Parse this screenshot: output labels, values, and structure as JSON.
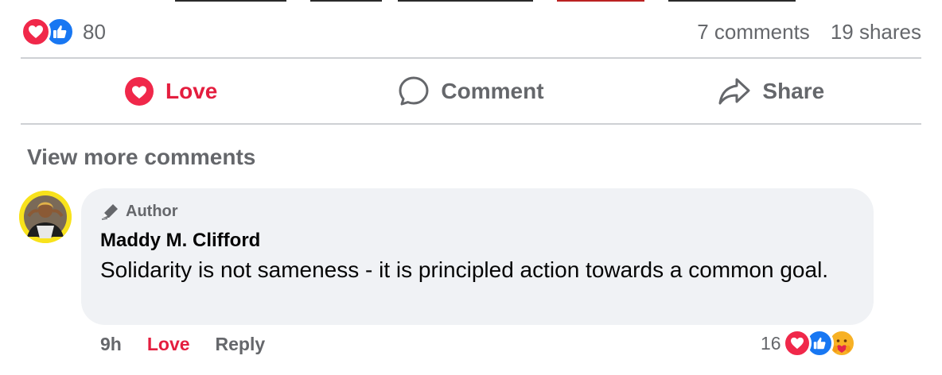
{
  "post": {
    "reaction_count": "80",
    "reaction_icons": [
      "love-icon",
      "like-icon"
    ],
    "comments_count": "7 comments",
    "shares_count": "19 shares"
  },
  "actions": {
    "love_label": "Love",
    "comment_label": "Comment",
    "share_label": "Share"
  },
  "comments_section": {
    "view_more": "View more comments",
    "comment": {
      "author_badge": "Author",
      "commenter_name": "Maddy M. Clifford",
      "text": "Solidarity is not sameness - it is principled action towards a common goal.",
      "time": "9h",
      "love_link": "Love",
      "reply_link": "Reply",
      "reaction_count": "16",
      "reaction_icons": [
        "love-icon",
        "like-icon",
        "care-icon"
      ]
    }
  },
  "colors": {
    "love_red": "#e41e3f",
    "like_blue": "#1877f2",
    "secondary_text": "#65676b",
    "bubble_bg": "#f0f2f5"
  }
}
